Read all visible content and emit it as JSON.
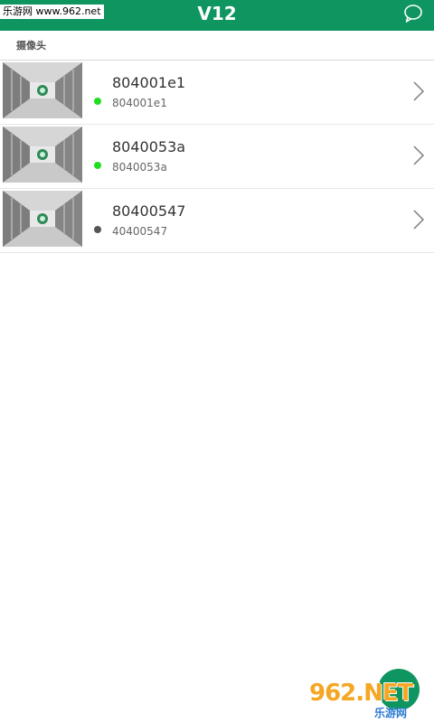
{
  "watermark_top": "乐游网 www.962.net",
  "app": {
    "title": "V12"
  },
  "section": {
    "label": "摄像头"
  },
  "cameras": [
    {
      "name": "804001e1",
      "subtitle": "804001e1",
      "status": "online",
      "status_color": "#22dd22"
    },
    {
      "name": "8040053a",
      "subtitle": "8040053a",
      "status": "online",
      "status_color": "#22dd22"
    },
    {
      "name": "80400547",
      "subtitle": "40400547",
      "status": "offline",
      "status_color": "#555555"
    }
  ],
  "watermark_bottom": {
    "main": "962.NET",
    "sub": "乐游网"
  },
  "colors": {
    "accent": "#0f9560"
  }
}
